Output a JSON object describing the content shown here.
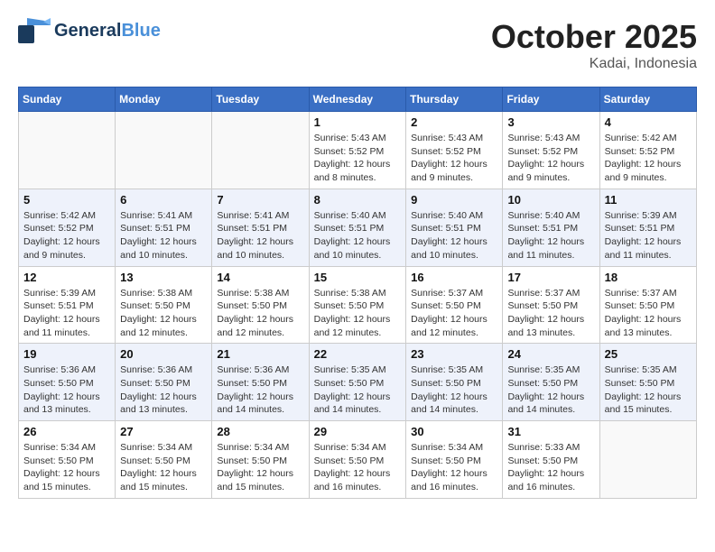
{
  "header": {
    "logo_general": "General",
    "logo_blue": "Blue",
    "month_year": "October 2025",
    "location": "Kadai, Indonesia"
  },
  "weekdays": [
    "Sunday",
    "Monday",
    "Tuesday",
    "Wednesday",
    "Thursday",
    "Friday",
    "Saturday"
  ],
  "weeks": [
    [
      {
        "day": "",
        "info": ""
      },
      {
        "day": "",
        "info": ""
      },
      {
        "day": "",
        "info": ""
      },
      {
        "day": "1",
        "info": "Sunrise: 5:43 AM\nSunset: 5:52 PM\nDaylight: 12 hours\nand 8 minutes."
      },
      {
        "day": "2",
        "info": "Sunrise: 5:43 AM\nSunset: 5:52 PM\nDaylight: 12 hours\nand 9 minutes."
      },
      {
        "day": "3",
        "info": "Sunrise: 5:43 AM\nSunset: 5:52 PM\nDaylight: 12 hours\nand 9 minutes."
      },
      {
        "day": "4",
        "info": "Sunrise: 5:42 AM\nSunset: 5:52 PM\nDaylight: 12 hours\nand 9 minutes."
      }
    ],
    [
      {
        "day": "5",
        "info": "Sunrise: 5:42 AM\nSunset: 5:52 PM\nDaylight: 12 hours\nand 9 minutes."
      },
      {
        "day": "6",
        "info": "Sunrise: 5:41 AM\nSunset: 5:51 PM\nDaylight: 12 hours\nand 10 minutes."
      },
      {
        "day": "7",
        "info": "Sunrise: 5:41 AM\nSunset: 5:51 PM\nDaylight: 12 hours\nand 10 minutes."
      },
      {
        "day": "8",
        "info": "Sunrise: 5:40 AM\nSunset: 5:51 PM\nDaylight: 12 hours\nand 10 minutes."
      },
      {
        "day": "9",
        "info": "Sunrise: 5:40 AM\nSunset: 5:51 PM\nDaylight: 12 hours\nand 10 minutes."
      },
      {
        "day": "10",
        "info": "Sunrise: 5:40 AM\nSunset: 5:51 PM\nDaylight: 12 hours\nand 11 minutes."
      },
      {
        "day": "11",
        "info": "Sunrise: 5:39 AM\nSunset: 5:51 PM\nDaylight: 12 hours\nand 11 minutes."
      }
    ],
    [
      {
        "day": "12",
        "info": "Sunrise: 5:39 AM\nSunset: 5:51 PM\nDaylight: 12 hours\nand 11 minutes."
      },
      {
        "day": "13",
        "info": "Sunrise: 5:38 AM\nSunset: 5:50 PM\nDaylight: 12 hours\nand 12 minutes."
      },
      {
        "day": "14",
        "info": "Sunrise: 5:38 AM\nSunset: 5:50 PM\nDaylight: 12 hours\nand 12 minutes."
      },
      {
        "day": "15",
        "info": "Sunrise: 5:38 AM\nSunset: 5:50 PM\nDaylight: 12 hours\nand 12 minutes."
      },
      {
        "day": "16",
        "info": "Sunrise: 5:37 AM\nSunset: 5:50 PM\nDaylight: 12 hours\nand 12 minutes."
      },
      {
        "day": "17",
        "info": "Sunrise: 5:37 AM\nSunset: 5:50 PM\nDaylight: 12 hours\nand 13 minutes."
      },
      {
        "day": "18",
        "info": "Sunrise: 5:37 AM\nSunset: 5:50 PM\nDaylight: 12 hours\nand 13 minutes."
      }
    ],
    [
      {
        "day": "19",
        "info": "Sunrise: 5:36 AM\nSunset: 5:50 PM\nDaylight: 12 hours\nand 13 minutes."
      },
      {
        "day": "20",
        "info": "Sunrise: 5:36 AM\nSunset: 5:50 PM\nDaylight: 12 hours\nand 13 minutes."
      },
      {
        "day": "21",
        "info": "Sunrise: 5:36 AM\nSunset: 5:50 PM\nDaylight: 12 hours\nand 14 minutes."
      },
      {
        "day": "22",
        "info": "Sunrise: 5:35 AM\nSunset: 5:50 PM\nDaylight: 12 hours\nand 14 minutes."
      },
      {
        "day": "23",
        "info": "Sunrise: 5:35 AM\nSunset: 5:50 PM\nDaylight: 12 hours\nand 14 minutes."
      },
      {
        "day": "24",
        "info": "Sunrise: 5:35 AM\nSunset: 5:50 PM\nDaylight: 12 hours\nand 14 minutes."
      },
      {
        "day": "25",
        "info": "Sunrise: 5:35 AM\nSunset: 5:50 PM\nDaylight: 12 hours\nand 15 minutes."
      }
    ],
    [
      {
        "day": "26",
        "info": "Sunrise: 5:34 AM\nSunset: 5:50 PM\nDaylight: 12 hours\nand 15 minutes."
      },
      {
        "day": "27",
        "info": "Sunrise: 5:34 AM\nSunset: 5:50 PM\nDaylight: 12 hours\nand 15 minutes."
      },
      {
        "day": "28",
        "info": "Sunrise: 5:34 AM\nSunset: 5:50 PM\nDaylight: 12 hours\nand 15 minutes."
      },
      {
        "day": "29",
        "info": "Sunrise: 5:34 AM\nSunset: 5:50 PM\nDaylight: 12 hours\nand 16 minutes."
      },
      {
        "day": "30",
        "info": "Sunrise: 5:34 AM\nSunset: 5:50 PM\nDaylight: 12 hours\nand 16 minutes."
      },
      {
        "day": "31",
        "info": "Sunrise: 5:33 AM\nSunset: 5:50 PM\nDaylight: 12 hours\nand 16 minutes."
      },
      {
        "day": "",
        "info": ""
      }
    ]
  ]
}
